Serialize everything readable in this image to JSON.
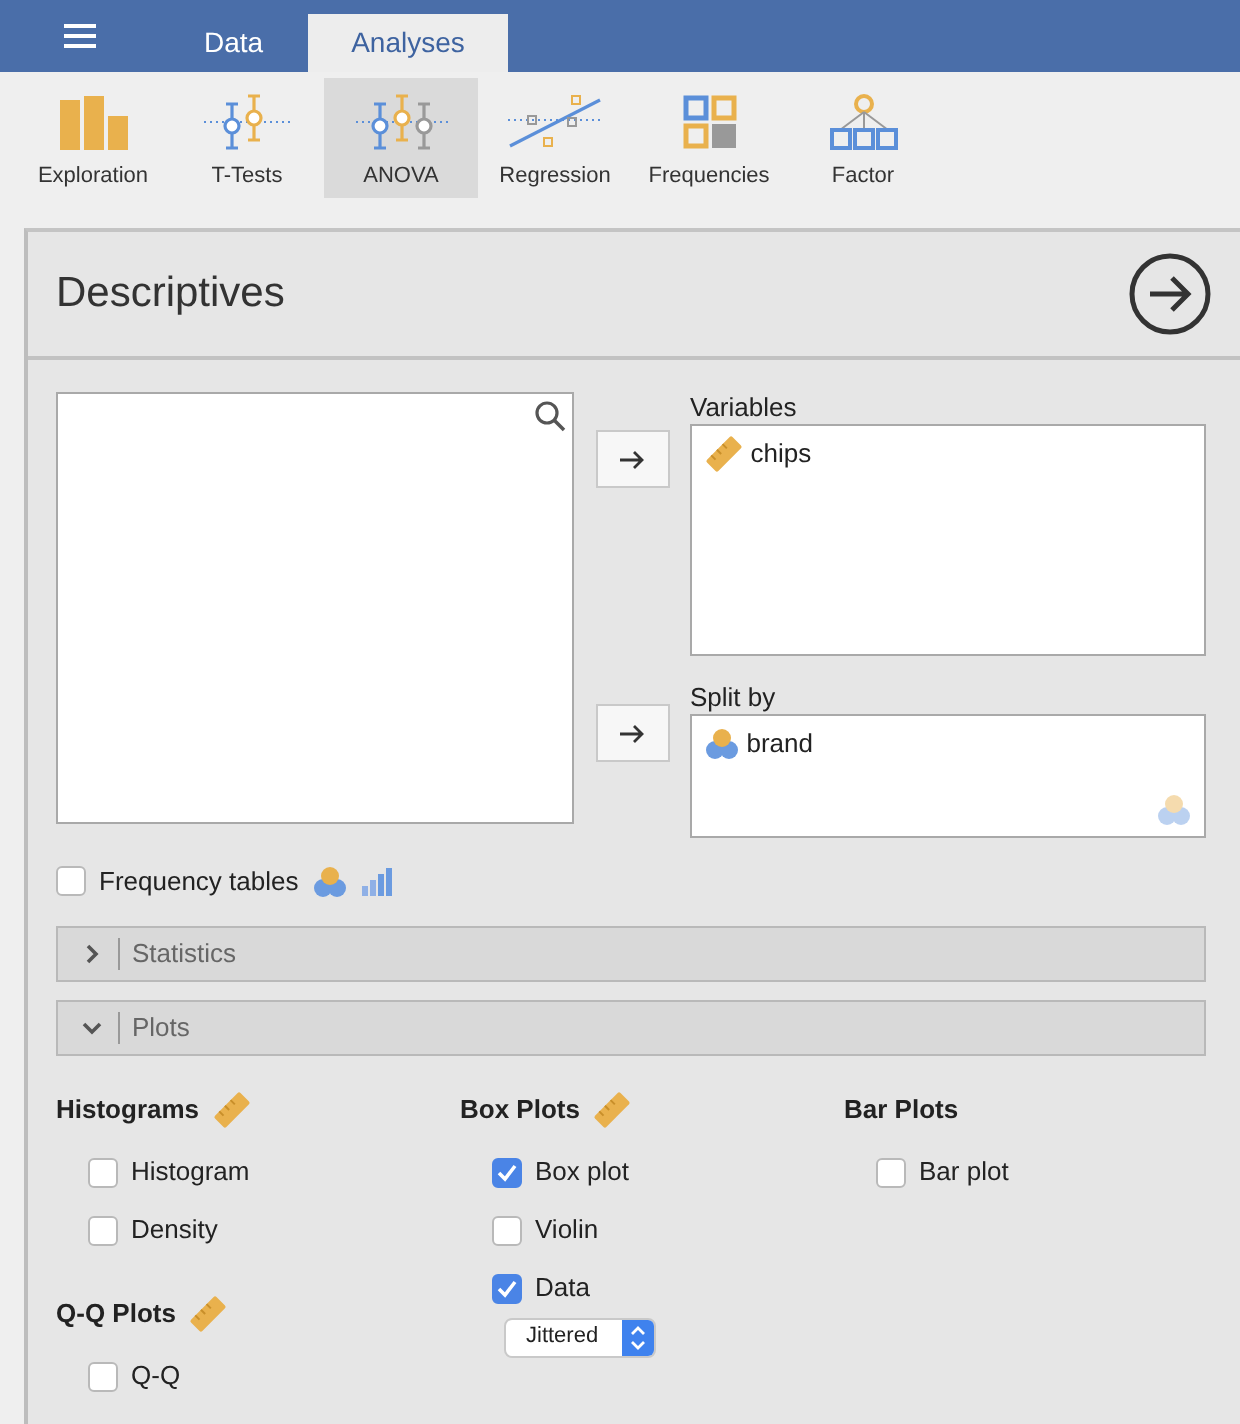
{
  "menu_tabs": [
    {
      "label": "Data",
      "selected": false
    },
    {
      "label": "Analyses",
      "selected": true
    }
  ],
  "ribbon": [
    {
      "label": "Exploration",
      "kind": "bars",
      "selected": false
    },
    {
      "label": "T-Tests",
      "kind": "ttest",
      "selected": false
    },
    {
      "label": "ANOVA",
      "kind": "anova",
      "selected": true
    },
    {
      "label": "Regression",
      "kind": "regression",
      "selected": false
    },
    {
      "label": "Frequencies",
      "kind": "grid",
      "selected": false
    },
    {
      "label": "Factor",
      "kind": "tree",
      "selected": false
    }
  ],
  "panel": {
    "title": "Descriptives"
  },
  "variables": {
    "label": "Variables",
    "items": [
      {
        "name": "chips",
        "kind": "continuous"
      }
    ]
  },
  "split_by": {
    "label": "Split by",
    "items": [
      {
        "name": "brand",
        "kind": "nominal"
      }
    ]
  },
  "frequency_tables": {
    "label": "Frequency tables",
    "checked": false
  },
  "sections": [
    {
      "label": "Statistics",
      "expanded": false
    },
    {
      "label": "Plots",
      "expanded": true
    }
  ],
  "plot_columns": [
    [
      {
        "title": "Histograms",
        "kind": "continuous",
        "options": [
          {
            "label": "Histogram",
            "kind": "checkbox",
            "checked": false
          },
          {
            "label": "Density",
            "kind": "checkbox",
            "checked": false
          }
        ]
      },
      {
        "title": "Q-Q Plots",
        "kind": "continuous",
        "options": [
          {
            "label": "Q-Q",
            "kind": "checkbox",
            "checked": false
          }
        ]
      }
    ],
    [
      {
        "title": "Box Plots",
        "kind": "continuous",
        "options": [
          {
            "label": "Box plot",
            "kind": "checkbox",
            "checked": true
          },
          {
            "label": "Violin",
            "kind": "checkbox",
            "checked": false
          },
          {
            "label": "Data",
            "kind": "checkbox",
            "checked": true
          },
          {
            "value": "Jittered",
            "kind": "select"
          }
        ]
      }
    ],
    [
      {
        "title": "Bar Plots",
        "kind": "any",
        "options": [
          {
            "label": "Bar plot",
            "kind": "checkbox",
            "checked": false
          }
        ]
      }
    ]
  ]
}
